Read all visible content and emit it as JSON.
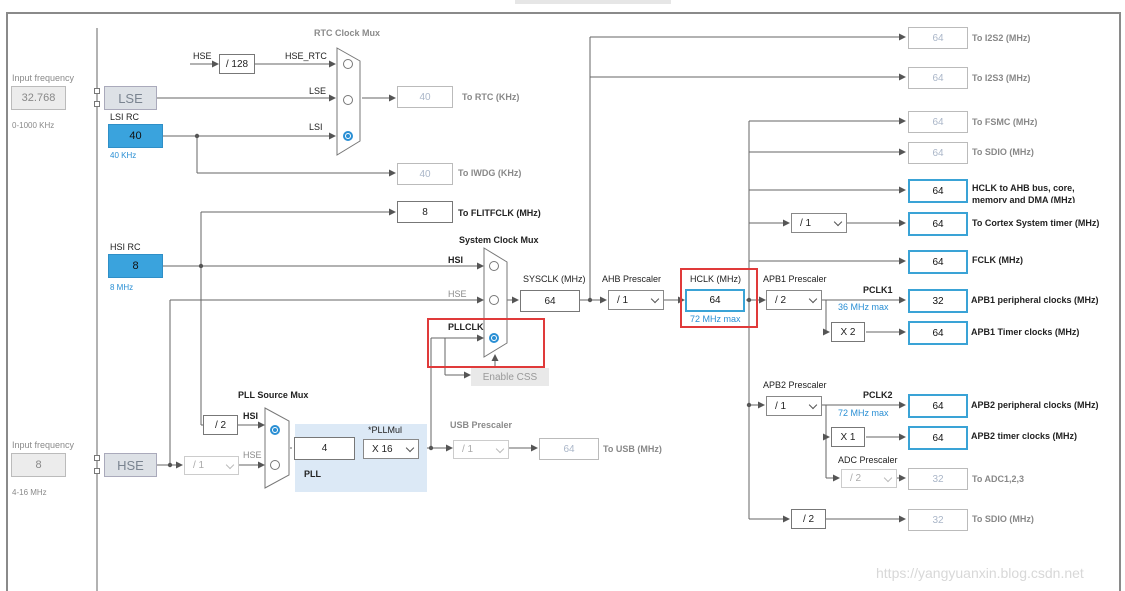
{
  "left": {
    "lse_input_label": "Input frequency",
    "lse_freq": "32.768",
    "lse_range": "0-1000 KHz",
    "lse": "LSE",
    "lsi_label": "LSI RC",
    "lsi_value": "40",
    "lsi_unit": "40 KHz",
    "hsi_label": "HSI RC",
    "hsi_value": "8",
    "hsi_unit": "8 MHz",
    "hse_input_label": "Input frequency",
    "hse_freq": "8",
    "hse_range": "4-16 MHz",
    "hse": "HSE"
  },
  "rtc": {
    "title": "RTC Clock Mux",
    "hse_in": "HSE",
    "div128": "/ 128",
    "hse_rtc": "HSE_RTC",
    "lse": "LSE",
    "lsi": "LSI",
    "rtc_value": "40",
    "rtc_label": "To RTC (KHz)",
    "iwdg_value": "40",
    "iwdg_label": "To IWDG (KHz)",
    "flit_value": "8",
    "flit_label": "To FLITFCLK (MHz)"
  },
  "sysmux": {
    "title": "System Clock Mux",
    "hsi": "HSI",
    "hse": "HSE",
    "pllclk": "PLLCLK",
    "enable_css": "Enable CSS"
  },
  "pll": {
    "title": "PLL Source Mux",
    "hsi": "HSI",
    "hse": "HSE",
    "div2": "/ 2",
    "hse_div": "/ 1",
    "pll_input": "4",
    "mul_label": "*PLLMul",
    "mul_value": "X 16",
    "pll_label": "PLL",
    "usb_prescaler_label": "USB Prescaler",
    "usb_prescaler": "/ 1",
    "usb_value": "64",
    "usb_label": "To USB (MHz)"
  },
  "core": {
    "sysclk_label": "SYSCLK (MHz)",
    "sysclk": "64",
    "ahb_label": "AHB Prescaler",
    "ahb": "/ 1",
    "hclk_label": "HCLK (MHz)",
    "hclk": "64",
    "hclk_max": "72 MHz max"
  },
  "outputs": {
    "i2s2_value": "64",
    "i2s2_label": "To I2S2 (MHz)",
    "i2s3_value": "64",
    "i2s3_label": "To I2S3 (MHz)",
    "fsmc_value": "64",
    "fsmc_label": "To FSMC (MHz)",
    "sdio1_value": "64",
    "sdio1_label": "To SDIO (MHz)",
    "ahb_value": "64",
    "ahb_label_1": "HCLK to AHB bus, core,",
    "ahb_label_2": "memory and DMA (MHz)",
    "cortex_div": "/ 1",
    "cortex_value": "64",
    "cortex_label": "To Cortex System timer (MHz)",
    "fclk_value": "64",
    "fclk_label": "FCLK (MHz)"
  },
  "apb1": {
    "prescaler_label": "APB1 Prescaler",
    "prescaler": "/ 2",
    "pclk": "PCLK1",
    "max": "36 MHz max",
    "periph_value": "32",
    "periph_label": "APB1 peripheral clocks (MHz)",
    "timer_mul": "X 2",
    "timer_value": "64",
    "timer_label": "APB1 Timer clocks (MHz)"
  },
  "apb2": {
    "prescaler_label": "APB2 Prescaler",
    "prescaler": "/ 1",
    "pclk": "PCLK2",
    "max": "72 MHz max",
    "periph_value": "64",
    "periph_label": "APB2 peripheral clocks (MHz)",
    "timer_mul": "X 1",
    "timer_value": "64",
    "timer_label": "APB2 timer clocks (MHz)",
    "adc_prescaler_label": "ADC Prescaler",
    "adc_prescaler": "/ 2",
    "adc_value": "32",
    "adc_label": "To ADC1,2,3",
    "sdio_div": "/ 2",
    "sdio_value": "32",
    "sdio_label": "To SDIO (MHz)"
  },
  "watermark": "https://yangyuanxin.blog.csdn.net",
  "colors": {
    "accent": "#3aa3dd",
    "highlight": "#e03a3a",
    "pll_bg": "#dce9f6"
  }
}
